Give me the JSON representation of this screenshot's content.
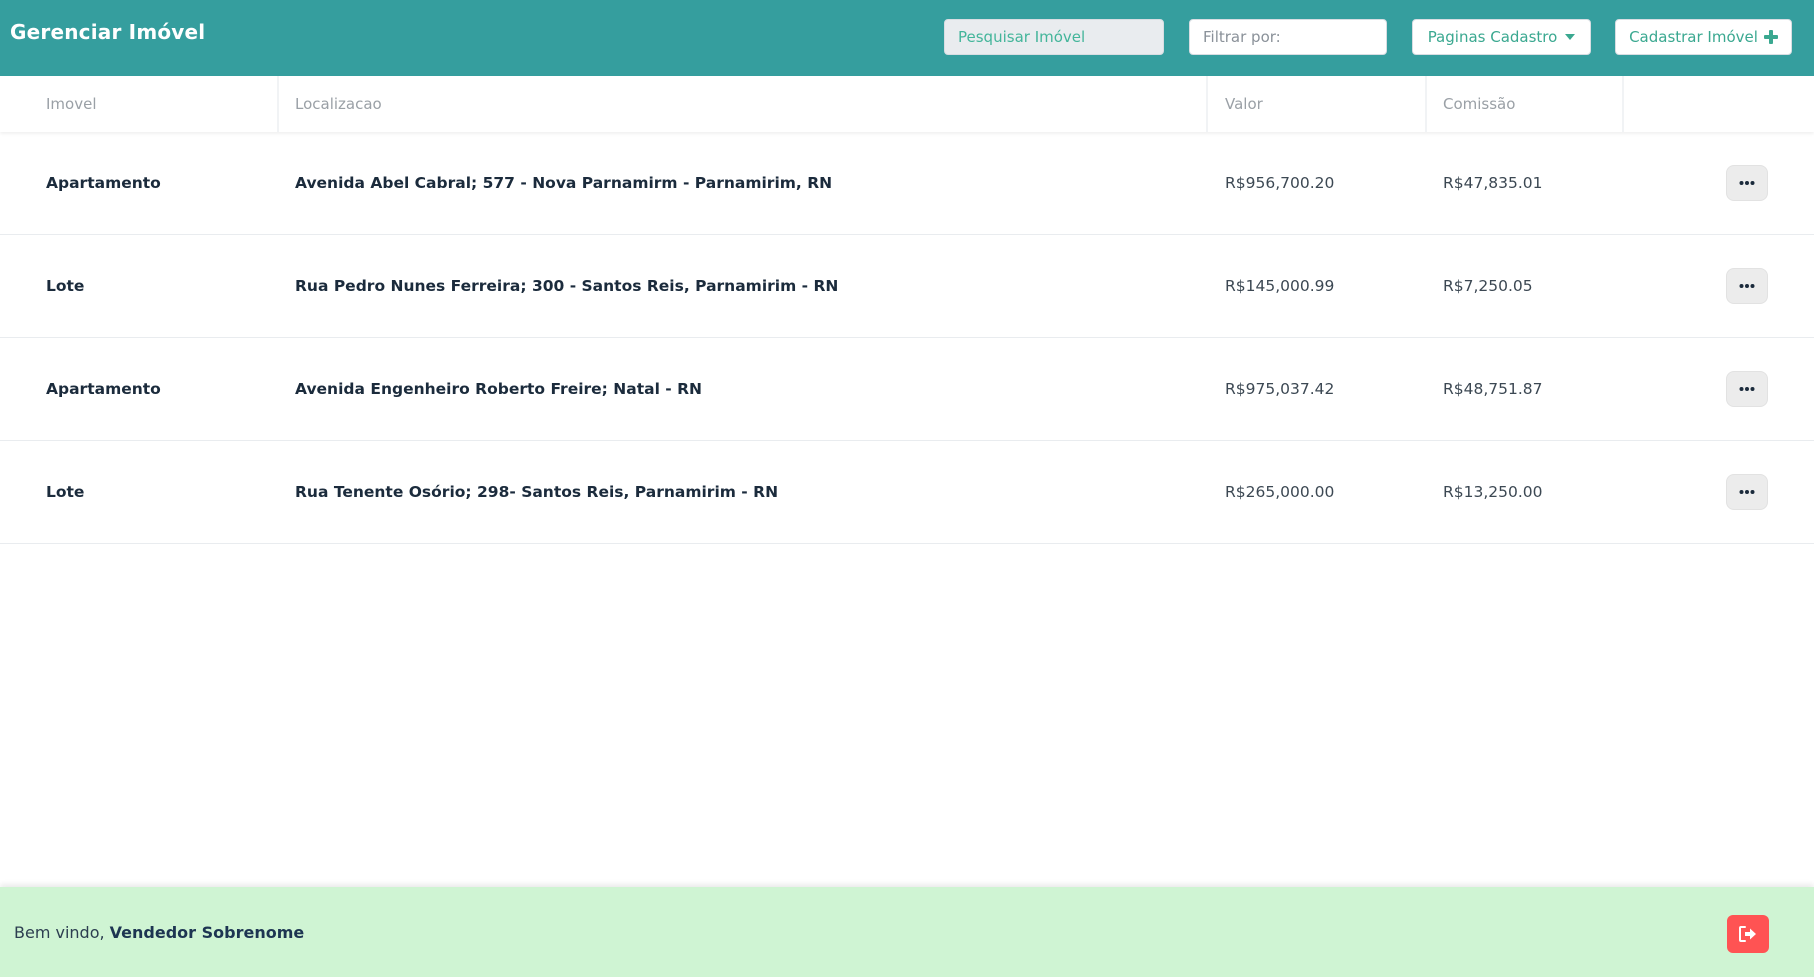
{
  "header": {
    "title": "Gerenciar Imóvel",
    "search_placeholder": "Pesquisar Imóvel",
    "filter_placeholder": "Filtrar por:",
    "pages_dropdown_label": "Paginas Cadastro",
    "add_button_label": "Cadastrar Imóvel",
    "accent_color": "#359e9e"
  },
  "table": {
    "columns": [
      "Imovel",
      "Localizacao",
      "Valor",
      "Comissão"
    ],
    "rows": [
      {
        "imovel": "Apartamento",
        "localizacao": "Avenida Abel Cabral; 577 - Nova Parnamirm - Parnamirim, RN",
        "valor": "R$956,700.20",
        "comissao": "R$47,835.01"
      },
      {
        "imovel": "Lote",
        "localizacao": "Rua Pedro Nunes Ferreira; 300 - Santos Reis, Parnamirim - RN",
        "valor": "R$145,000.99",
        "comissao": "R$7,250.05"
      },
      {
        "imovel": "Apartamento",
        "localizacao": "Avenida Engenheiro Roberto Freire; Natal - RN",
        "valor": "R$975,037.42",
        "comissao": "R$48,751.87"
      },
      {
        "imovel": "Lote",
        "localizacao": "Rua Tenente Osório; 298- Santos Reis, Parnamirim - RN",
        "valor": "R$265,000.00",
        "comissao": "R$13,250.00"
      }
    ],
    "row_action_icon": "more-horizontal-icon"
  },
  "footer": {
    "welcome_text": "Bem vindo, ",
    "user_name": "Vendedor Sobrenome",
    "logout_icon": "sign-out-icon",
    "background_color": "#cff4d3",
    "logout_color": "#ff5353"
  }
}
